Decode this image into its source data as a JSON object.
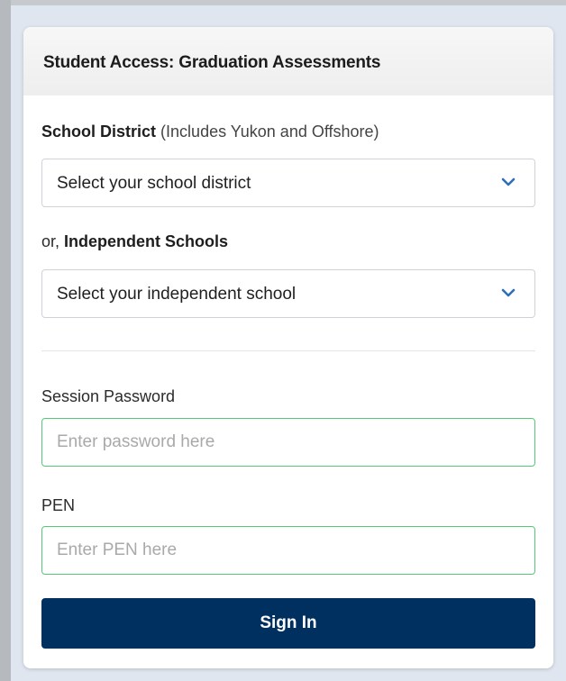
{
  "card": {
    "title": "Student Access: Graduation Assessments"
  },
  "district": {
    "label_bold": "School District",
    "label_note": "(Includes Yukon and Offshore)",
    "select_value": "Select your school district",
    "icon": "chevron-down-icon"
  },
  "independent": {
    "label_prefix": "or,",
    "label_bold": "Independent Schools",
    "select_value": "Select your independent school",
    "icon": "chevron-down-icon"
  },
  "password": {
    "label": "Session Password",
    "placeholder": "Enter password here"
  },
  "pen": {
    "label": "PEN",
    "placeholder": "Enter PEN here"
  },
  "signin": {
    "label": "Sign In"
  },
  "colors": {
    "primary_button": "#00305f",
    "input_focus_border": "#57c77a",
    "chevron": "#2f6fb8"
  }
}
